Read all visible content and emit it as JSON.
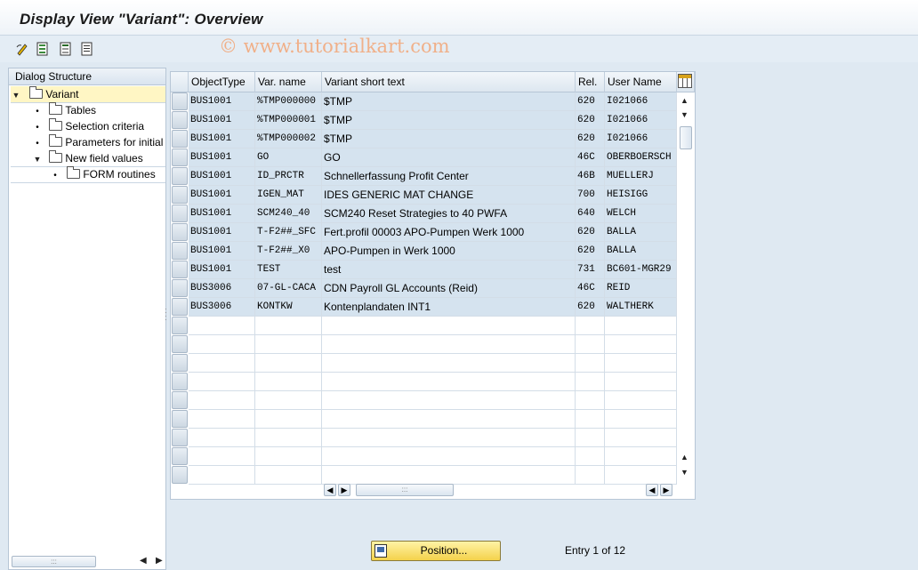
{
  "window": {
    "title": "Display View \"Variant\": Overview"
  },
  "toolbar": {
    "icons": [
      "other-view-icon",
      "select-all-icon",
      "print-icon",
      "details-icon"
    ]
  },
  "watermark": "© www.tutorialkart.com",
  "dialog_structure": {
    "header": "Dialog Structure",
    "items": [
      {
        "label": "Variant",
        "level": 0,
        "expanded": true,
        "selected": true
      },
      {
        "label": "Tables",
        "level": 1
      },
      {
        "label": "Selection criteria",
        "level": 1
      },
      {
        "label": "Parameters for initial",
        "level": 1
      },
      {
        "label": "New field values",
        "level": 1,
        "expanded": true
      },
      {
        "label": "FORM routines",
        "level": 2
      }
    ]
  },
  "table": {
    "columns": [
      "ObjectType",
      "Var. name",
      "Variant short text",
      "Rel.",
      "User Name"
    ],
    "rows": [
      [
        "BUS1001",
        "%TMP000000",
        "$TMP",
        "620",
        "I021066"
      ],
      [
        "BUS1001",
        "%TMP000001",
        "$TMP",
        "620",
        "I021066"
      ],
      [
        "BUS1001",
        "%TMP000002",
        "$TMP",
        "620",
        "I021066"
      ],
      [
        "BUS1001",
        "GO",
        "GO",
        "46C",
        "OBERBOERSCH"
      ],
      [
        "BUS1001",
        "ID_PRCTR",
        "Schnellerfassung Profit Center",
        "46B",
        "MUELLERJ"
      ],
      [
        "BUS1001",
        "IGEN_MAT",
        "IDES GENERIC MAT CHANGE",
        "700",
        "HEISIGG"
      ],
      [
        "BUS1001",
        "SCM240_40",
        "SCM240 Reset Strategies to 40 PWFA",
        "640",
        "WELCH"
      ],
      [
        "BUS1001",
        "T-F2##_SFC",
        "Fert.profil 00003 APO-Pumpen Werk 1000",
        "620",
        "BALLA"
      ],
      [
        "BUS1001",
        "T-F2##_X0",
        "APO-Pumpen in Werk 1000",
        "620",
        "BALLA"
      ],
      [
        "BUS1001",
        "TEST",
        "test",
        "731",
        "BC601-MGR29"
      ],
      [
        "BUS3006",
        "07-GL-CACA",
        "CDN Payroll GL Accounts (Reid)",
        "46C",
        "REID"
      ],
      [
        "BUS3006",
        "KONTKW",
        "Kontenplandaten INT1",
        "620",
        "WALTHERK"
      ]
    ],
    "empty_rows": 9
  },
  "footer": {
    "position_button": "Position...",
    "entry_text": "Entry 1 of 12"
  }
}
